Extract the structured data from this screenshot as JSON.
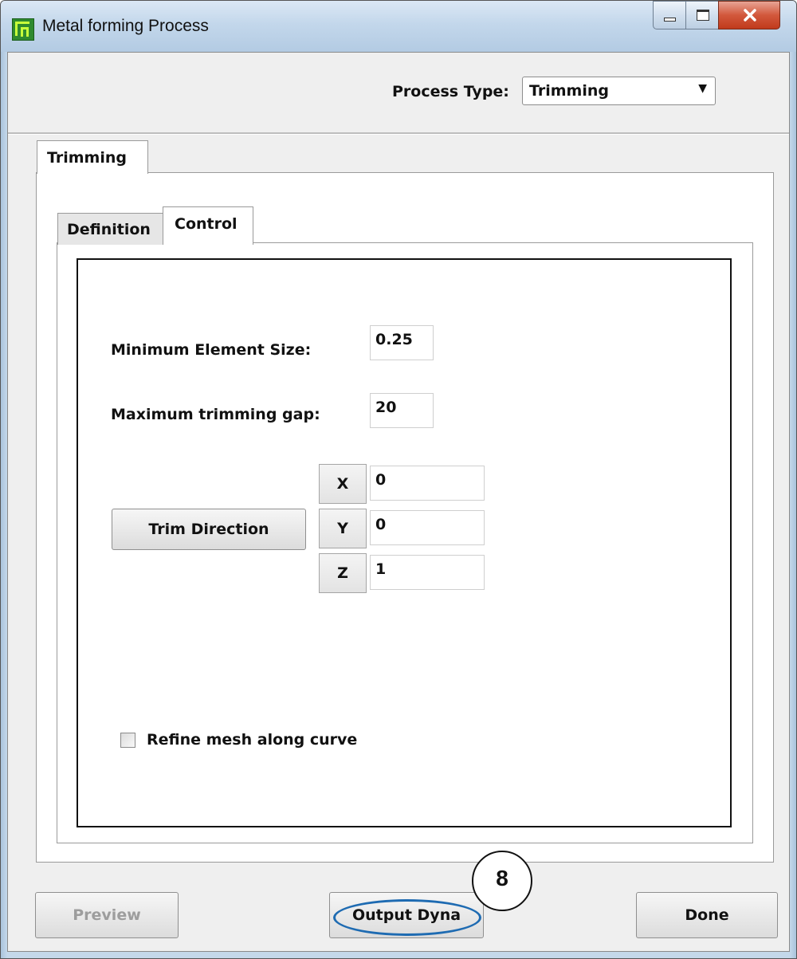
{
  "window": {
    "title": "Metal forming Process"
  },
  "header": {
    "process_type_label": "Process Type:",
    "process_type_value": "Trimming"
  },
  "tabs": {
    "outer": "Trimming",
    "inner": [
      "Definition",
      "Control"
    ]
  },
  "control": {
    "min_element_size_label": "Minimum Element Size:",
    "min_element_size_value": "0.25",
    "max_trimming_gap_label": "Maximum trimming gap:",
    "max_trimming_gap_value": "20",
    "trim_direction_label": "Trim Direction",
    "axes": [
      {
        "axis": "X",
        "value": "0"
      },
      {
        "axis": "Y",
        "value": "0"
      },
      {
        "axis": "Z",
        "value": "1"
      }
    ],
    "refine_mesh_label": "Refine mesh along curve",
    "refine_mesh_checked": false
  },
  "footer": {
    "preview": "Preview",
    "output_dyna": "Output Dyna",
    "done": "Done"
  },
  "annotation": {
    "callout_number": "8",
    "highlight_color": "#1e6bb2"
  }
}
